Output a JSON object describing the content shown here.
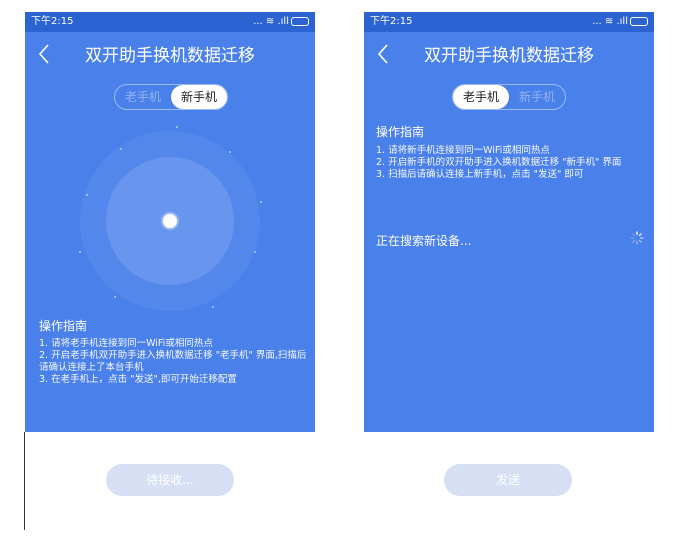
{
  "left_phone": {
    "status_time": "下午2:15",
    "status_icons": "... ≋ .ıll",
    "title": "双开助手换机数据迁移",
    "tab_old": "老手机",
    "tab_new": "新手机",
    "guide_title": "操作指南",
    "steps": [
      "1. 请将老手机连接到同一WiFi或相同热点",
      "2. 开启老手机双开助手进入换机数据迁移 \"老手机\" 界面,扫描后请确认连接上了本台手机",
      "3. 在老手机上，点击 \"发送\",即可开始迁移配置"
    ],
    "button_label": "待接收..."
  },
  "right_phone": {
    "status_time": "下午2:15",
    "status_icons": "... ≋ .ıll",
    "title": "双开助手换机数据迁移",
    "tab_old": "老手机",
    "tab_new": "新手机",
    "guide_title": "操作指南",
    "steps": [
      "1. 请将新手机连接到同一WiFi或相同热点",
      "2. 开启新手机的双开助手进入换机数据迁移 \"新手机\" 界面",
      "3. 扫描后请确认连接上新手机，点击 \"发送\" 即可"
    ],
    "searching_text": "正在搜索新设备...",
    "button_label": "发送"
  },
  "colors": {
    "primary": "#4a80ea",
    "status_bar": "#2c63d2",
    "button_disabled": "#d6dff3"
  }
}
